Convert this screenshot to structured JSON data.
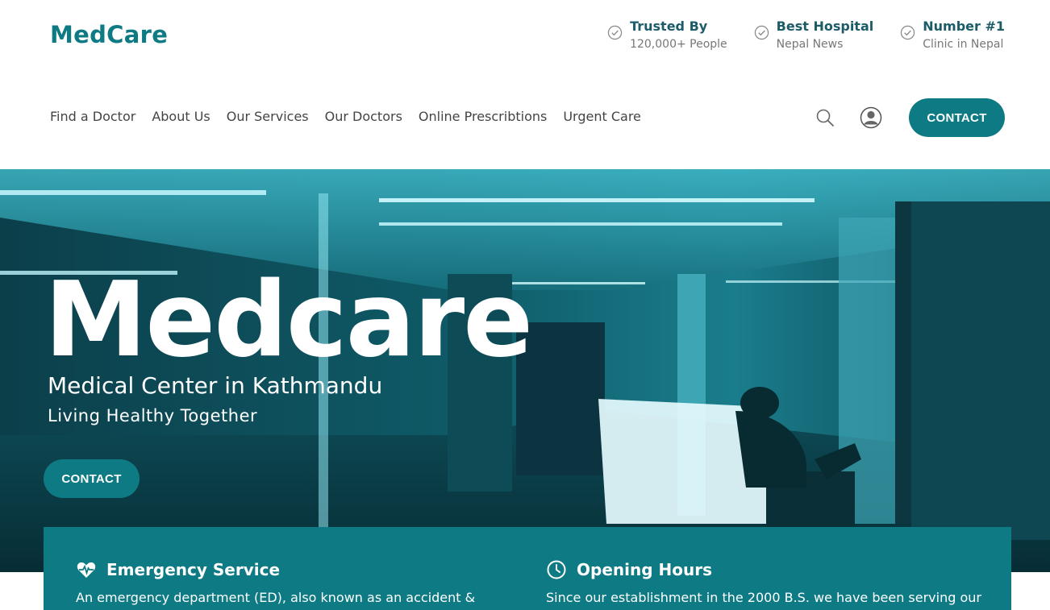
{
  "brand": {
    "logo": "MedCare",
    "accent": "#0e7a84"
  },
  "badges": [
    {
      "title": "Trusted By",
      "subtitle": "120,000+ People",
      "icon": "check-circle-icon"
    },
    {
      "title": "Best Hospital",
      "subtitle": "Nepal News",
      "icon": "check-circle-icon"
    },
    {
      "title": "Number #1",
      "subtitle": "Clinic in Nepal",
      "icon": "check-circle-icon"
    }
  ],
  "nav": {
    "items": [
      "Find a Doctor",
      "About Us",
      "Our Services",
      "Our Doctors",
      "Online Prescribtions",
      "Urgent Care"
    ],
    "contact_label": "CONTACT",
    "search_icon": "search-icon",
    "user_icon": "user-icon"
  },
  "hero": {
    "title": "Medcare",
    "subtitle": "Medical Center in Kathmandu",
    "tagline": "Living Healthy Together",
    "contact_label": "CONTACT"
  },
  "info": {
    "emergency": {
      "title": "Emergency Service",
      "text": "An emergency department (ED), also known as an accident &",
      "icon": "heartbeat-icon"
    },
    "hours": {
      "title": "Opening Hours",
      "text": "Since our establishment in the 2000 B.S. we have been serving our",
      "icon": "clock-icon"
    }
  }
}
